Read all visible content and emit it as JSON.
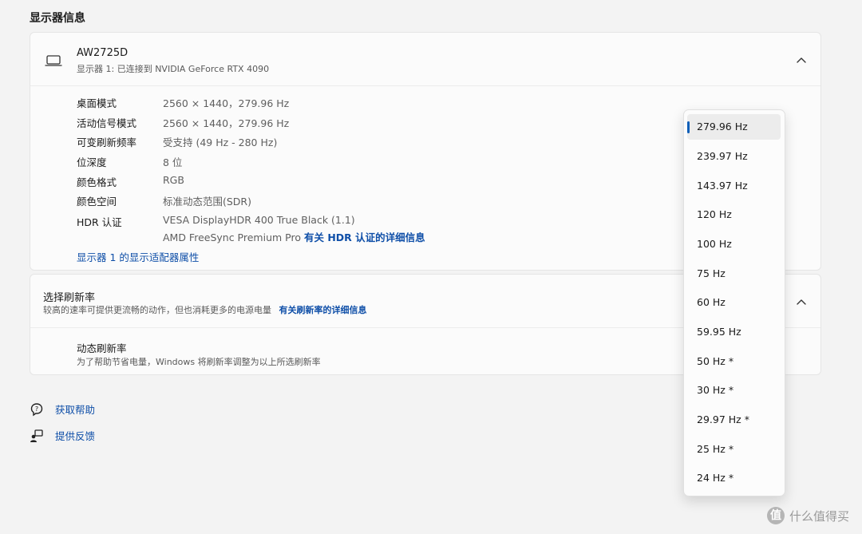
{
  "section_title": "显示器信息",
  "monitor": {
    "name": "AW2725D",
    "subtitle": "显示器 1: 已连接到 NVIDIA GeForce RTX 4090",
    "icon": "laptop-icon"
  },
  "properties": {
    "desktop_mode": {
      "label": "桌面模式",
      "value": "2560 × 1440，279.96 Hz"
    },
    "signal_mode": {
      "label": "活动信号模式",
      "value": "2560 × 1440，279.96 Hz"
    },
    "vrr": {
      "label": "可变刷新频率",
      "value": "受支持 (49 Hz - 280 Hz)"
    },
    "bit_depth": {
      "label": "位深度",
      "value": "8 位"
    },
    "color_format": {
      "label": "颜色格式",
      "value": "RGB"
    },
    "color_space": {
      "label": "颜色空间",
      "value": "标准动态范围(SDR)"
    },
    "hdr": {
      "label": "HDR 认证",
      "value_line1": "VESA DisplayHDR 400 True Black (1.1)",
      "value_line2": "AMD FreeSync Premium Pro",
      "link": "有关 HDR 认证的详细信息"
    }
  },
  "adapter_link": "显示器 1 的显示适配器属性",
  "refresh_rate": {
    "title": "选择刷新率",
    "subtitle": "较高的速率可提供更流畅的动作，但也消耗更多的电源电量",
    "link": "有关刷新率的详细信息"
  },
  "dynamic_refresh": {
    "title": "动态刷新率",
    "subtitle": "为了帮助节省电量，Windows 将刷新率调整为以上所选刷新率"
  },
  "help": {
    "get_help": "获取帮助",
    "feedback": "提供反馈"
  },
  "dropdown": {
    "selected": "279.96 Hz",
    "options": [
      "279.96 Hz",
      "239.97 Hz",
      "143.97 Hz",
      "120 Hz",
      "100 Hz",
      "75 Hz",
      "60 Hz",
      "59.95 Hz",
      "50 Hz *",
      "30 Hz *",
      "29.97 Hz *",
      "25 Hz *",
      "24 Hz *"
    ]
  },
  "watermark": "什么值得买",
  "watermark_logo": "值"
}
